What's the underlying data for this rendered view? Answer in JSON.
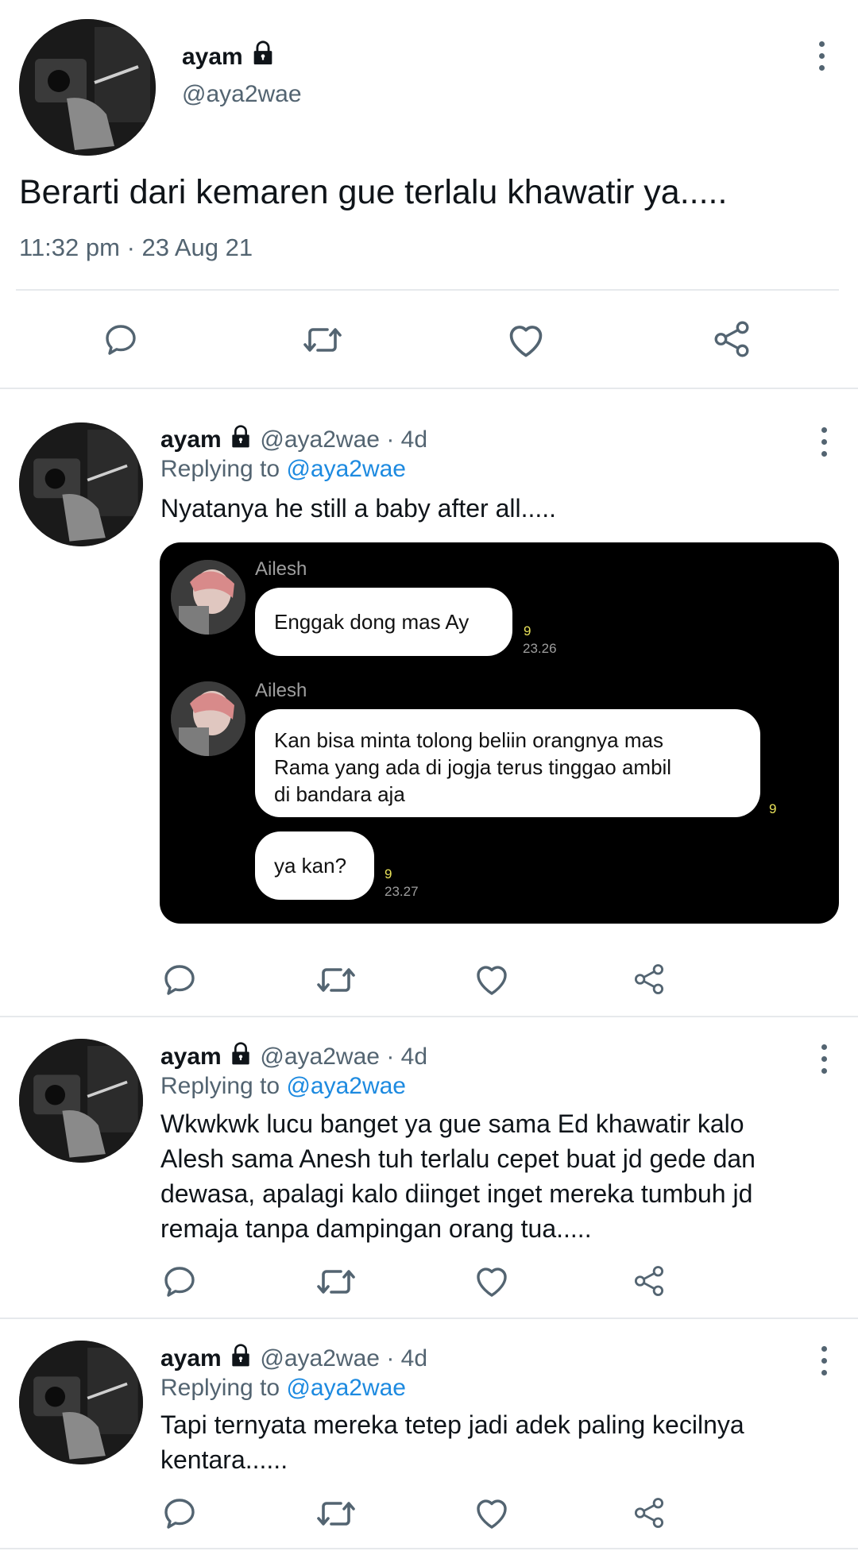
{
  "main_tweet": {
    "display_name": "ayam",
    "handle": "@aya2wae",
    "text": "Berarti dari kemaren gue terlalu khawatir ya.....",
    "timestamp": "11:32 pm · 23 Aug 21"
  },
  "replies": [
    {
      "display_name": "ayam",
      "handle": "@aya2wae",
      "age": "· 4d",
      "replying_prefix": "Replying to",
      "replying_handle": "@aya2wae",
      "text": "Nyatanya he still a baby after all.....",
      "attachment": {
        "messages": [
          {
            "sender": "Ailesh",
            "text": "Enggak dong mas Ay",
            "read_count": "9",
            "time": "23.26"
          },
          {
            "sender": "Ailesh",
            "text_lines": [
              "Kan bisa minta tolong beliin orangnya mas",
              "Rama yang ada di jogja terus tinggao ambil",
              "di bandara aja"
            ],
            "read_count": "9"
          },
          {
            "text": "ya kan?",
            "read_count": "9",
            "time": "23.27"
          }
        ]
      }
    },
    {
      "display_name": "ayam",
      "handle": "@aya2wae",
      "age": "· 4d",
      "replying_prefix": "Replying to",
      "replying_handle": "@aya2wae",
      "text_lines": [
        "Wkwkwk lucu banget ya gue sama Ed khawatir kalo",
        "Alesh sama Anesh tuh terlalu cepet buat jd gede dan",
        "dewasa, apalagi kalo diinget inget mereka tumbuh jd",
        "remaja tanpa dampingan orang tua....."
      ]
    },
    {
      "display_name": "ayam",
      "handle": "@aya2wae",
      "age": "· 4d",
      "replying_prefix": "Replying to",
      "replying_handle": "@aya2wae",
      "text_lines": [
        "Tapi ternyata mereka tetep jadi adek paling kecilnya",
        "kentara......"
      ]
    }
  ],
  "icons": {
    "reply": "speech-bubble-icon",
    "retweet": "retweet-icon",
    "like": "heart-icon",
    "share": "share-icon",
    "lock": "lock-icon",
    "more": "vertical-dots-icon"
  },
  "colors": {
    "text": "#0f1419",
    "secondary": "#536471",
    "link": "#1d8ae0",
    "read_receipt": "#e9e25a"
  }
}
